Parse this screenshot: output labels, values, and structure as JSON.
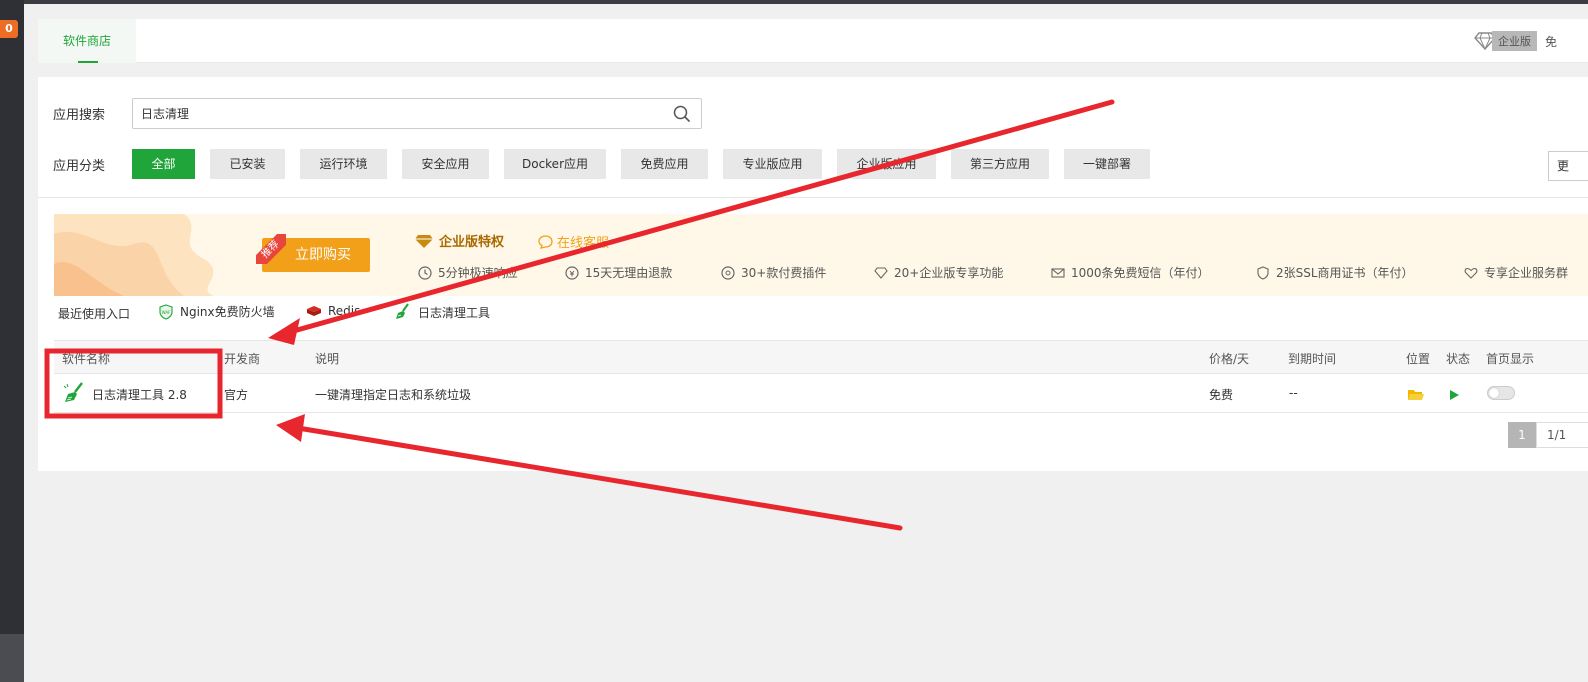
{
  "sidebar": {
    "badge": "0"
  },
  "tabs": {
    "active_label": "软件商店"
  },
  "header": {
    "enterprise_label": "企业版",
    "free_label": "免"
  },
  "search": {
    "label": "应用搜索",
    "value": "日志清理"
  },
  "categories": {
    "label": "应用分类",
    "items": [
      {
        "label": "全部",
        "active": true
      },
      {
        "label": "已安装"
      },
      {
        "label": "运行环境"
      },
      {
        "label": "安全应用"
      },
      {
        "label": "Docker应用"
      },
      {
        "label": "免费应用"
      },
      {
        "label": "专业版应用"
      },
      {
        "label": "企业版应用"
      },
      {
        "label": "第三方应用"
      },
      {
        "label": "一键部署"
      }
    ],
    "more_label": "更"
  },
  "banner": {
    "recommend_tag": "推荐",
    "buy_label": "立即购买",
    "title": "企业版特权",
    "online_service": "在线客服",
    "features": [
      "5分钟极速响应",
      "15天无理由退款",
      "30+款付费插件",
      "20+企业版专享功能",
      "1000条免费短信（年付）",
      "2张SSL商用证书（年付）",
      "专享企业服务群"
    ]
  },
  "recent": {
    "label": "最近使用入口",
    "items": [
      "Nginx免费防火墙",
      "Redis",
      "日志清理工具"
    ]
  },
  "table": {
    "headers": {
      "name": "软件名称",
      "developer": "开发商",
      "desc": "说明",
      "price": "价格/天",
      "expire": "到期时间",
      "location": "位置",
      "status": "状态",
      "homepage": "首页显示"
    },
    "rows": [
      {
        "name": "日志清理工具 2.8",
        "developer": "官方",
        "desc": "一键清理指定日志和系统垃圾",
        "price": "免费",
        "expire": "--"
      }
    ]
  },
  "pagination": {
    "current": "1",
    "info": "1/1"
  },
  "colors": {
    "accent": "#20a53a",
    "annotation": "#e8262d",
    "banner_orange": "#f2a01a"
  }
}
